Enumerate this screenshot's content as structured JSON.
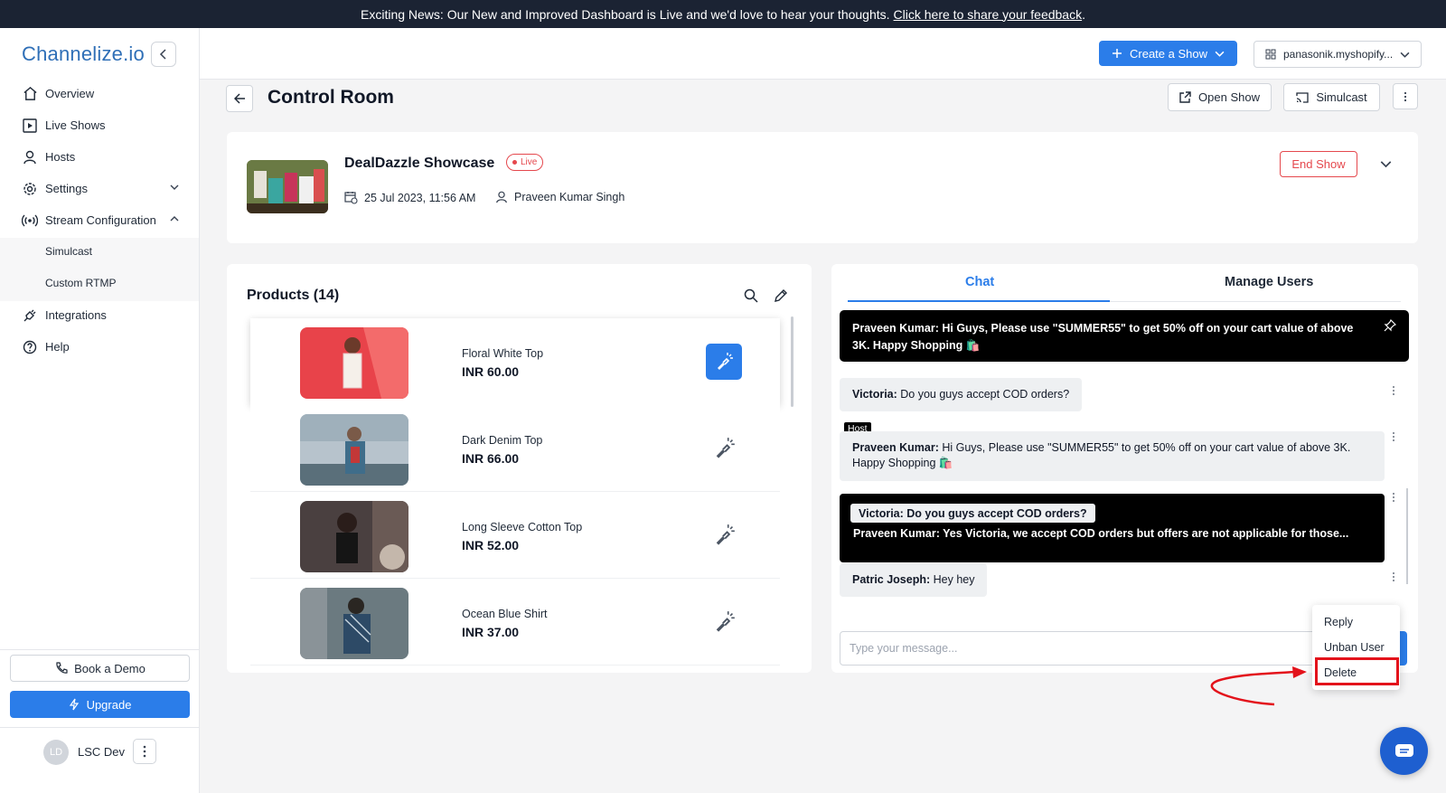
{
  "banner": {
    "text": "Exciting News: Our New and Improved Dashboard is Live and we'd love to hear your thoughts.",
    "link": "Click here to share your feedback",
    "suffix": "."
  },
  "sidebar": {
    "logo": "Channelize.io",
    "items": [
      {
        "label": "Overview",
        "icon": "home-icon"
      },
      {
        "label": "Live Shows",
        "icon": "play-square-icon"
      },
      {
        "label": "Hosts",
        "icon": "user-icon"
      },
      {
        "label": "Settings",
        "icon": "gear-icon"
      },
      {
        "label": "Stream Configuration",
        "icon": "broadcast-icon"
      },
      {
        "label": "Integrations",
        "icon": "plug-icon"
      },
      {
        "label": "Help",
        "icon": "help-icon"
      }
    ],
    "sub_items": [
      "Simulcast",
      "Custom RTMP"
    ],
    "book_demo": "Book a Demo",
    "upgrade": "Upgrade",
    "user": {
      "initials": "LD",
      "name": "LSC Dev"
    }
  },
  "topbar": {
    "create_show": "Create a Show",
    "store": "panasonik.myshopify..."
  },
  "page": {
    "title": "Control Room",
    "open_show": "Open Show",
    "simulcast": "Simulcast"
  },
  "show": {
    "title": "DealDazzle Showcase",
    "status": "Live",
    "datetime": "25 Jul 2023, 11:56 AM",
    "host": "Praveen Kumar Singh",
    "end_show": "End Show"
  },
  "products": {
    "title": "Products (14)",
    "items": [
      {
        "name": "Floral White Top",
        "price": "INR 60.00",
        "selected": true
      },
      {
        "name": "Dark Denim Top",
        "price": "INR 66.00",
        "selected": false
      },
      {
        "name": "Long Sleeve Cotton Top",
        "price": "INR 52.00",
        "selected": false
      },
      {
        "name": "Ocean Blue Shirt",
        "price": "INR 37.00",
        "selected": false
      }
    ]
  },
  "chat": {
    "tabs": [
      "Chat",
      "Manage Users"
    ],
    "pinned": {
      "author": "Praveen Kumar:",
      "text": "Hi Guys, Please use \"SUMMER55\" to get 50% off on your cart value of above 3K. Happy Shopping 🛍️"
    },
    "messages": [
      {
        "author": "Victoria:",
        "text": "Do you guys accept COD orders?"
      },
      {
        "author": "Praveen Kumar:",
        "text": "Hi Guys, Please use \"SUMMER55\" to get 50% off on your cart value of above 3K. Happy Shopping 🛍️",
        "tag": "Host"
      },
      {
        "author": "Patric Joseph:",
        "text": "Hey hey"
      }
    ],
    "reply": {
      "quoted": "Victoria: Do you guys accept COD orders?",
      "author": "Praveen Kumar:",
      "text": "Yes Victoria, we accept COD orders but offers are not applicable for those..."
    },
    "input_placeholder": "Type your message..."
  },
  "context_menu": {
    "items": [
      "Reply",
      "Unban User",
      "Delete"
    ]
  },
  "colors": {
    "accent": "#2b7de9",
    "danger": "#e5484d",
    "banner": "#1b2333",
    "annotation": "#e3121b"
  }
}
